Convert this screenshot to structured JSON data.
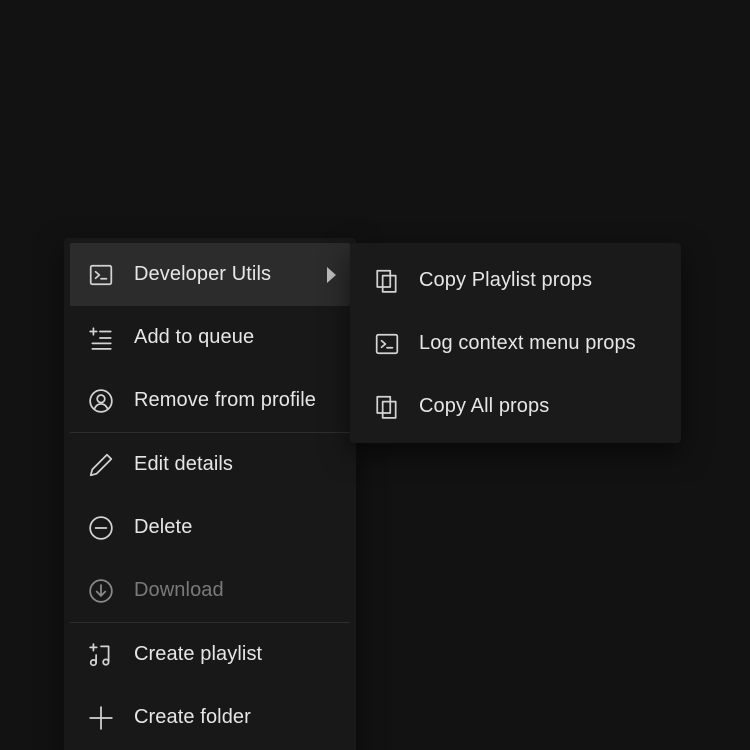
{
  "context_menu": {
    "items": [
      {
        "label": "Developer Utils",
        "icon": "terminal-icon",
        "has_submenu": true,
        "active": true
      },
      {
        "label": "Add to queue",
        "icon": "add-to-queue-icon"
      },
      {
        "label": "Remove from profile",
        "icon": "user-circle-icon"
      },
      {
        "label": "Edit details",
        "icon": "pencil-icon"
      },
      {
        "label": "Delete",
        "icon": "minus-circle-icon"
      },
      {
        "label": "Download",
        "icon": "download-circle-icon",
        "disabled": true
      },
      {
        "label": "Create playlist",
        "icon": "add-music-icon"
      },
      {
        "label": "Create folder",
        "icon": "plus-icon"
      }
    ]
  },
  "submenu": {
    "items": [
      {
        "label": "Copy Playlist props",
        "icon": "copy-icon"
      },
      {
        "label": "Log context menu props",
        "icon": "terminal-icon"
      },
      {
        "label": "Copy All props",
        "icon": "copy-icon"
      }
    ]
  },
  "colors": {
    "background": "#121212",
    "menu_background": "#181818",
    "active_item": "#2c2c2c",
    "text": "#e6e6e6",
    "disabled_text": "#7a7a7a"
  }
}
